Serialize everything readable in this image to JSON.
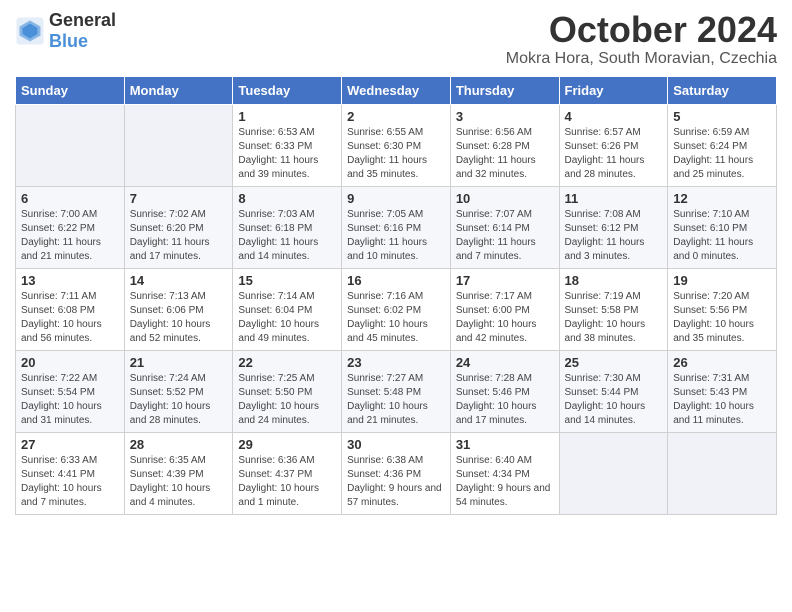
{
  "header": {
    "logo": {
      "text_general": "General",
      "text_blue": "Blue"
    },
    "title": "October 2024",
    "location": "Mokra Hora, South Moravian, Czechia"
  },
  "days_of_week": [
    "Sunday",
    "Monday",
    "Tuesday",
    "Wednesday",
    "Thursday",
    "Friday",
    "Saturday"
  ],
  "weeks": [
    [
      {
        "day": "",
        "info": ""
      },
      {
        "day": "",
        "info": ""
      },
      {
        "day": "1",
        "info": "Sunrise: 6:53 AM\nSunset: 6:33 PM\nDaylight: 11 hours and 39 minutes."
      },
      {
        "day": "2",
        "info": "Sunrise: 6:55 AM\nSunset: 6:30 PM\nDaylight: 11 hours and 35 minutes."
      },
      {
        "day": "3",
        "info": "Sunrise: 6:56 AM\nSunset: 6:28 PM\nDaylight: 11 hours and 32 minutes."
      },
      {
        "day": "4",
        "info": "Sunrise: 6:57 AM\nSunset: 6:26 PM\nDaylight: 11 hours and 28 minutes."
      },
      {
        "day": "5",
        "info": "Sunrise: 6:59 AM\nSunset: 6:24 PM\nDaylight: 11 hours and 25 minutes."
      }
    ],
    [
      {
        "day": "6",
        "info": "Sunrise: 7:00 AM\nSunset: 6:22 PM\nDaylight: 11 hours and 21 minutes."
      },
      {
        "day": "7",
        "info": "Sunrise: 7:02 AM\nSunset: 6:20 PM\nDaylight: 11 hours and 17 minutes."
      },
      {
        "day": "8",
        "info": "Sunrise: 7:03 AM\nSunset: 6:18 PM\nDaylight: 11 hours and 14 minutes."
      },
      {
        "day": "9",
        "info": "Sunrise: 7:05 AM\nSunset: 6:16 PM\nDaylight: 11 hours and 10 minutes."
      },
      {
        "day": "10",
        "info": "Sunrise: 7:07 AM\nSunset: 6:14 PM\nDaylight: 11 hours and 7 minutes."
      },
      {
        "day": "11",
        "info": "Sunrise: 7:08 AM\nSunset: 6:12 PM\nDaylight: 11 hours and 3 minutes."
      },
      {
        "day": "12",
        "info": "Sunrise: 7:10 AM\nSunset: 6:10 PM\nDaylight: 11 hours and 0 minutes."
      }
    ],
    [
      {
        "day": "13",
        "info": "Sunrise: 7:11 AM\nSunset: 6:08 PM\nDaylight: 10 hours and 56 minutes."
      },
      {
        "day": "14",
        "info": "Sunrise: 7:13 AM\nSunset: 6:06 PM\nDaylight: 10 hours and 52 minutes."
      },
      {
        "day": "15",
        "info": "Sunrise: 7:14 AM\nSunset: 6:04 PM\nDaylight: 10 hours and 49 minutes."
      },
      {
        "day": "16",
        "info": "Sunrise: 7:16 AM\nSunset: 6:02 PM\nDaylight: 10 hours and 45 minutes."
      },
      {
        "day": "17",
        "info": "Sunrise: 7:17 AM\nSunset: 6:00 PM\nDaylight: 10 hours and 42 minutes."
      },
      {
        "day": "18",
        "info": "Sunrise: 7:19 AM\nSunset: 5:58 PM\nDaylight: 10 hours and 38 minutes."
      },
      {
        "day": "19",
        "info": "Sunrise: 7:20 AM\nSunset: 5:56 PM\nDaylight: 10 hours and 35 minutes."
      }
    ],
    [
      {
        "day": "20",
        "info": "Sunrise: 7:22 AM\nSunset: 5:54 PM\nDaylight: 10 hours and 31 minutes."
      },
      {
        "day": "21",
        "info": "Sunrise: 7:24 AM\nSunset: 5:52 PM\nDaylight: 10 hours and 28 minutes."
      },
      {
        "day": "22",
        "info": "Sunrise: 7:25 AM\nSunset: 5:50 PM\nDaylight: 10 hours and 24 minutes."
      },
      {
        "day": "23",
        "info": "Sunrise: 7:27 AM\nSunset: 5:48 PM\nDaylight: 10 hours and 21 minutes."
      },
      {
        "day": "24",
        "info": "Sunrise: 7:28 AM\nSunset: 5:46 PM\nDaylight: 10 hours and 17 minutes."
      },
      {
        "day": "25",
        "info": "Sunrise: 7:30 AM\nSunset: 5:44 PM\nDaylight: 10 hours and 14 minutes."
      },
      {
        "day": "26",
        "info": "Sunrise: 7:31 AM\nSunset: 5:43 PM\nDaylight: 10 hours and 11 minutes."
      }
    ],
    [
      {
        "day": "27",
        "info": "Sunrise: 6:33 AM\nSunset: 4:41 PM\nDaylight: 10 hours and 7 minutes."
      },
      {
        "day": "28",
        "info": "Sunrise: 6:35 AM\nSunset: 4:39 PM\nDaylight: 10 hours and 4 minutes."
      },
      {
        "day": "29",
        "info": "Sunrise: 6:36 AM\nSunset: 4:37 PM\nDaylight: 10 hours and 1 minute."
      },
      {
        "day": "30",
        "info": "Sunrise: 6:38 AM\nSunset: 4:36 PM\nDaylight: 9 hours and 57 minutes."
      },
      {
        "day": "31",
        "info": "Sunrise: 6:40 AM\nSunset: 4:34 PM\nDaylight: 9 hours and 54 minutes."
      },
      {
        "day": "",
        "info": ""
      },
      {
        "day": "",
        "info": ""
      }
    ]
  ]
}
